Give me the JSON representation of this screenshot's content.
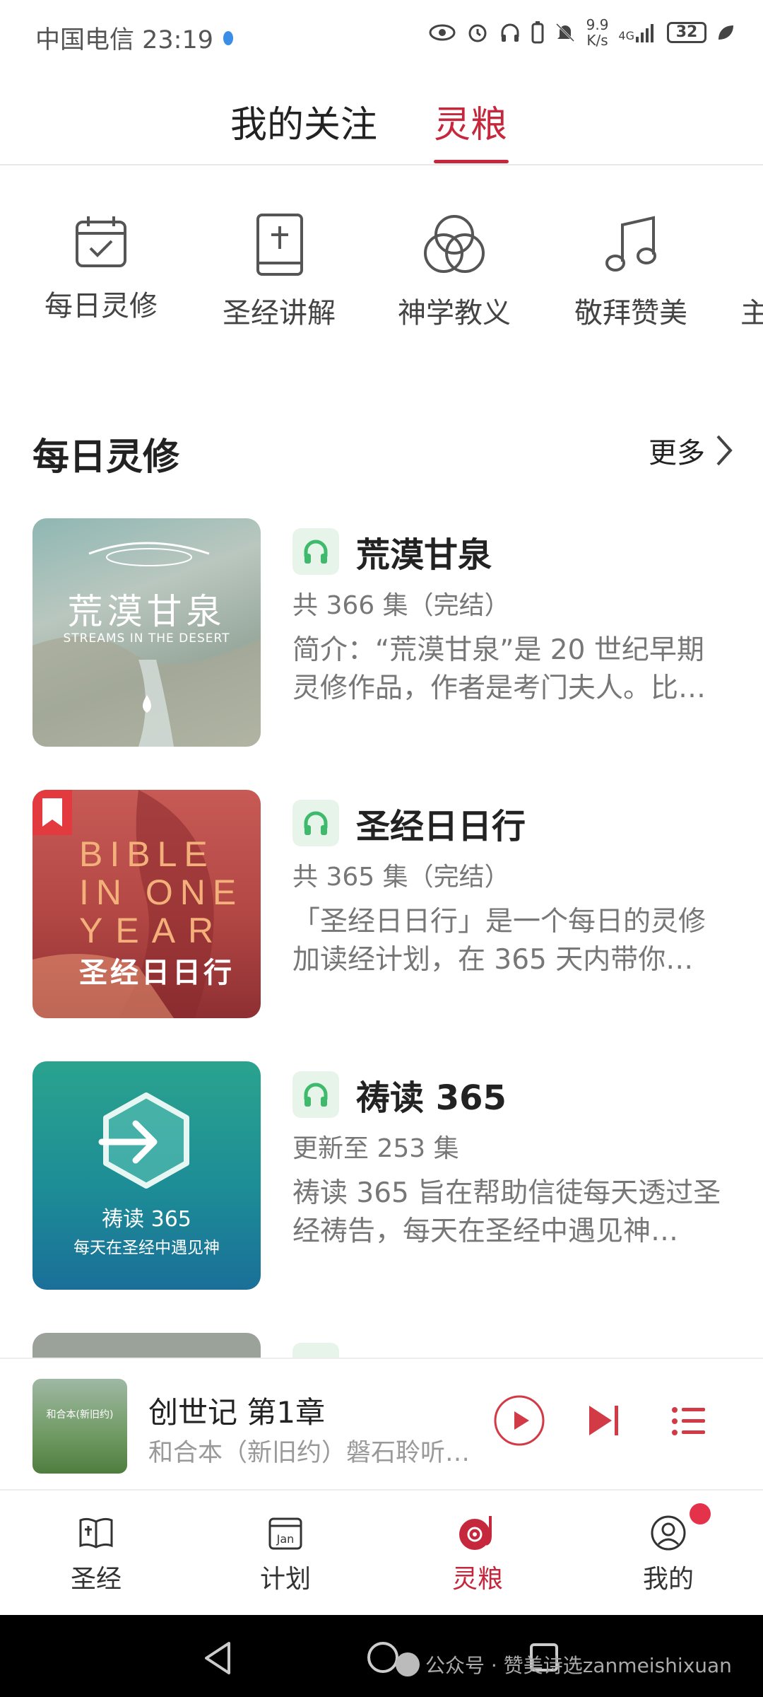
{
  "status_bar": {
    "carrier_time": "中国电信 23:19",
    "speed_value": "9.9",
    "speed_unit": "K/s",
    "network": "4G",
    "battery": "32"
  },
  "top_tabs": [
    "我的关注",
    "灵粮"
  ],
  "active_tab": "灵粮",
  "categories": [
    {
      "label": "每日灵修",
      "icon": "calendar-check-icon"
    },
    {
      "label": "圣经讲解",
      "icon": "bible-book-icon"
    },
    {
      "label": "神学教义",
      "icon": "rings-icon"
    },
    {
      "label": "敬拜赞美",
      "icon": "music-note-icon"
    },
    {
      "label": "主",
      "icon": "category-icon"
    }
  ],
  "section": {
    "title": "每日灵修",
    "more": "更多"
  },
  "items": [
    {
      "title": "荒漠甘泉",
      "count": "共 366 集（完结）",
      "desc": "简介：“荒漠甘泉”是 20 世纪早期灵修作品，作者是考门夫人。比…",
      "cover_title": "荒漠甘泉",
      "cover_subtitle": "STREAMS IN THE DESERT"
    },
    {
      "title": "圣经日日行",
      "count": "共 365 集（完结）",
      "desc": "「圣经日日行」是一个每日的灵修加读经计划，在 365 天内带你…",
      "cover_en1": "BIBLE",
      "cover_en2": "IN ONE",
      "cover_en3": "YEAR",
      "cover_title": "圣经日日行"
    },
    {
      "title": "祷读 365",
      "count": "更新至 253 集",
      "desc": "祷读 365 旨在帮助信徒每天透过圣经祷告，每天在圣经中遇见神…",
      "cover_title": "祷读 365",
      "cover_subtitle": "每天在圣经中遇见神"
    }
  ],
  "player": {
    "title": "创世记 第1章",
    "subtitle": "和合本（新旧约）磐石聆听…",
    "cover_label": "和合本(新旧约)"
  },
  "bottom_nav": [
    {
      "label": "圣经",
      "icon": "bible-icon"
    },
    {
      "label": "计划",
      "icon": "calendar-jan-icon",
      "icon_text": "Jan"
    },
    {
      "label": "灵粮",
      "icon": "record-icon"
    },
    {
      "label": "我的",
      "icon": "user-icon"
    }
  ],
  "watermark": "公众号 · 赞美诗选zanmeishixuan",
  "colors": {
    "accent": "#c5283d",
    "headphone_badge": "#e6f4ea",
    "headphone_icon": "#3fba6c"
  }
}
